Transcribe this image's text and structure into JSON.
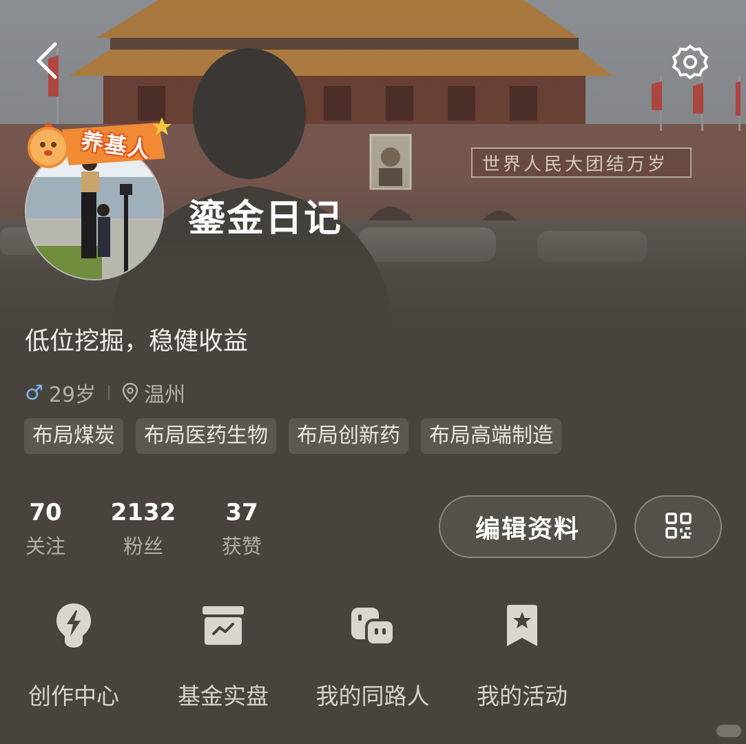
{
  "header": {
    "back_icon": "chevron-left-icon",
    "settings_icon": "gear-icon"
  },
  "profile": {
    "badge_text": "养基人",
    "username": "鎏金日记",
    "bio": "低位挖掘，稳健收益",
    "gender_symbol": "♂",
    "age": "29岁",
    "location": "温州",
    "tags": [
      "布局煤炭",
      "布局医药生物",
      "布局创新药",
      "布局高端制造"
    ]
  },
  "stats": {
    "following": {
      "value": "70",
      "label": "关注"
    },
    "followers": {
      "value": "2132",
      "label": "粉丝"
    },
    "likes": {
      "value": "37",
      "label": "获赞"
    }
  },
  "actions": {
    "edit_label": "编辑资料",
    "qr_icon": "qr-code-icon"
  },
  "shortcuts": [
    {
      "label": "创作中心",
      "icon": "lightbulb-icon"
    },
    {
      "label": "基金实盘",
      "icon": "fund-box-icon"
    },
    {
      "label": "我的同路人",
      "icon": "chat-bubbles-icon"
    },
    {
      "label": "我的活动",
      "icon": "bookmark-star-icon"
    }
  ],
  "colors": {
    "background": "#48443d",
    "gender_blue": "#7db3e8",
    "badge_orange": "#f08a34"
  }
}
